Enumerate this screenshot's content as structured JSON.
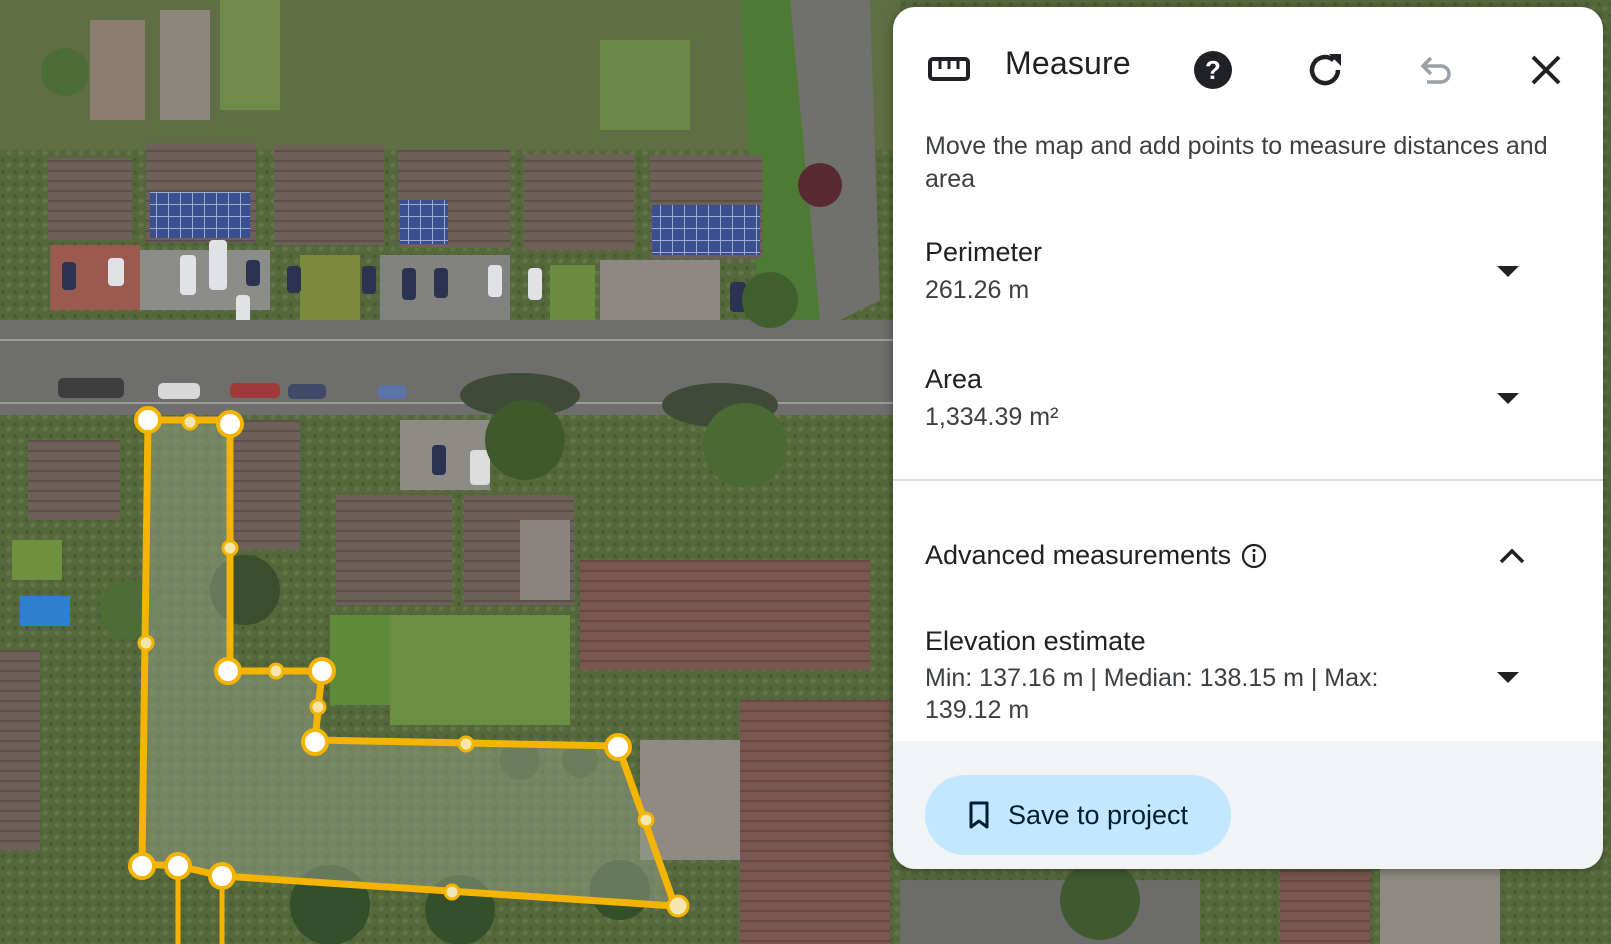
{
  "panel": {
    "title": "Measure",
    "subtitle": "Move the map and add points to measure distances and area",
    "icons": {
      "ruler": "ruler-icon",
      "help": "help-icon",
      "reset": "refresh-icon",
      "undo": "undo-icon",
      "close": "close-icon"
    },
    "perimeter": {
      "label": "Perimeter",
      "value": "261.26 m"
    },
    "area": {
      "label": "Area",
      "value": "1,334.39 m²"
    },
    "advanced": {
      "label": "Advanced measurements"
    },
    "elevation": {
      "label": "Elevation estimate",
      "value": "Min: 137.16 m | Median: 138.15 m | Max: 139.12 m"
    },
    "save_label": "Save to project"
  },
  "colors": {
    "accent_button": "#c2e7ff",
    "measure_line": "#f4b400",
    "panel_bg": "#ffffff"
  }
}
